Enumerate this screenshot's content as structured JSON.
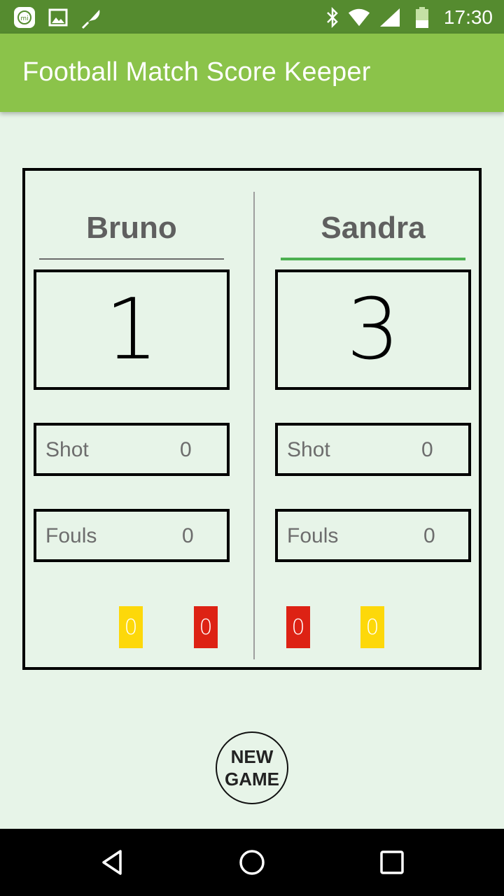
{
  "status_bar": {
    "time": "17:30",
    "left_icons": [
      "mi-icon",
      "image-icon",
      "feather-icon"
    ],
    "right_icons": [
      "bluetooth-icon",
      "wifi-icon",
      "cell-signal-icon",
      "battery-icon"
    ]
  },
  "app_bar": {
    "title": "Football Match Score Keeper",
    "color": "#8bc34a"
  },
  "teams": [
    {
      "name": "Bruno",
      "score": "1",
      "shot_label": "Shot",
      "shot_value": "0",
      "fouls_label": "Fouls",
      "fouls_value": "0",
      "yellow_cards": "0",
      "red_cards": "0"
    },
    {
      "name": "Sandra",
      "score": "3",
      "shot_label": "Shot",
      "shot_value": "0",
      "fouls_label": "Fouls",
      "fouls_value": "0",
      "yellow_cards": "0",
      "red_cards": "0"
    }
  ],
  "new_game_button": {
    "line1": "NEW",
    "line2": "GAME"
  },
  "colors": {
    "yellow_card": "#fdd80a",
    "red_card": "#dd2214",
    "selected_underline": "#4caf50"
  },
  "nav_bar": {
    "icons": [
      "back-icon",
      "home-icon",
      "recents-icon"
    ]
  }
}
